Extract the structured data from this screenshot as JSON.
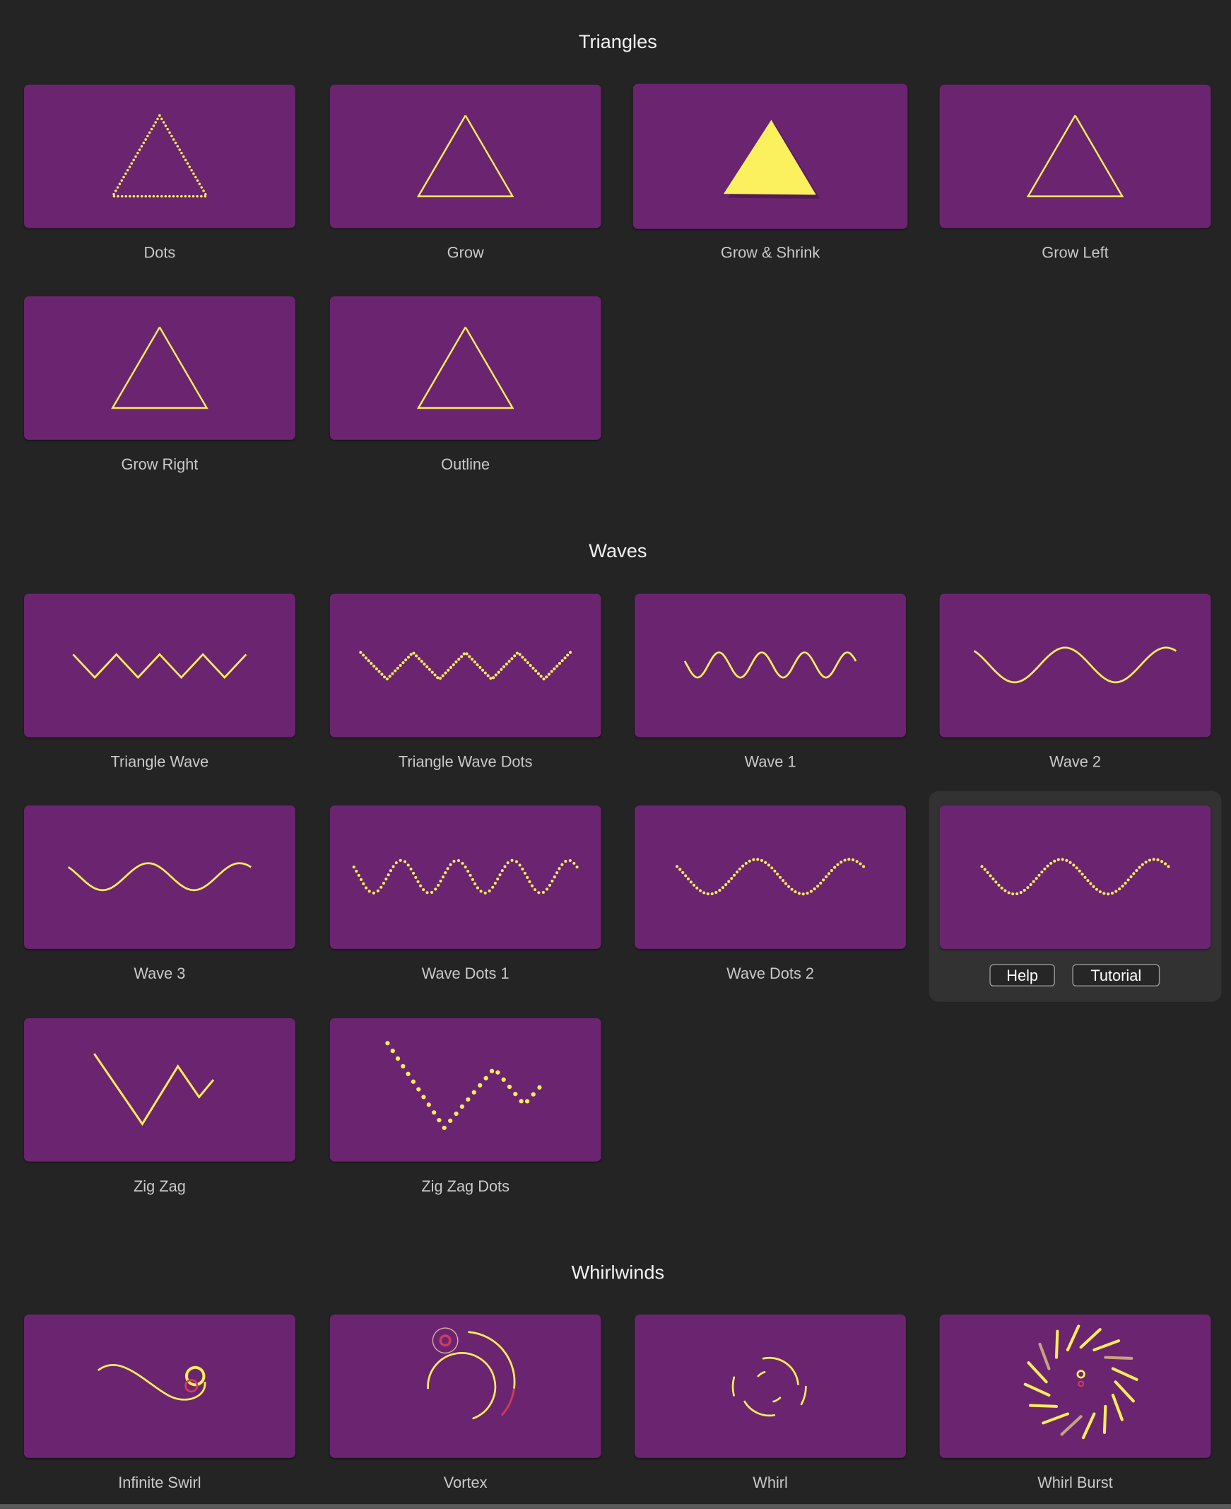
{
  "colors": {
    "background": "#242424",
    "tile": "#6b2570",
    "stroke": "#f8ec5a",
    "accent": "#d23c5a"
  },
  "sections": [
    {
      "title": "Triangles",
      "items": [
        {
          "label": "Dots",
          "preview": "triangle-dots"
        },
        {
          "label": "Grow",
          "preview": "triangle-outline"
        },
        {
          "label": "Grow & Shrink",
          "preview": "triangle-filled"
        },
        {
          "label": "Grow Left",
          "preview": "triangle-outline"
        },
        {
          "label": "Grow Right",
          "preview": "triangle-outline"
        },
        {
          "label": "Outline",
          "preview": "triangle-outline"
        }
      ]
    },
    {
      "title": "Waves",
      "items": [
        {
          "label": "Triangle Wave",
          "preview": "triwave"
        },
        {
          "label": "Triangle Wave Dots",
          "preview": "triwave-dots"
        },
        {
          "label": "Wave 1",
          "preview": "wave1"
        },
        {
          "label": "Wave 2",
          "preview": "wave2"
        },
        {
          "label": "Wave 3",
          "preview": "wave3"
        },
        {
          "label": "Wave Dots 1",
          "preview": "wavedots1"
        },
        {
          "label": "Wave Dots 2",
          "preview": "wavedots2"
        },
        {
          "label": "",
          "preview": "wavedots2"
        },
        {
          "label": "Zig Zag",
          "preview": "zigzag"
        },
        {
          "label": "Zig Zag Dots",
          "preview": "zigzag-dots"
        }
      ]
    },
    {
      "title": "Whirlwinds",
      "items": [
        {
          "label": "Infinite Swirl",
          "preview": "swirl"
        },
        {
          "label": "Vortex",
          "preview": "vortex"
        },
        {
          "label": "Whirl",
          "preview": "whirl"
        },
        {
          "label": "Whirl Burst",
          "preview": "whirlburst"
        }
      ]
    }
  ],
  "hover_panel": {
    "help_label": "Help",
    "tutorial_label": "Tutorial"
  }
}
